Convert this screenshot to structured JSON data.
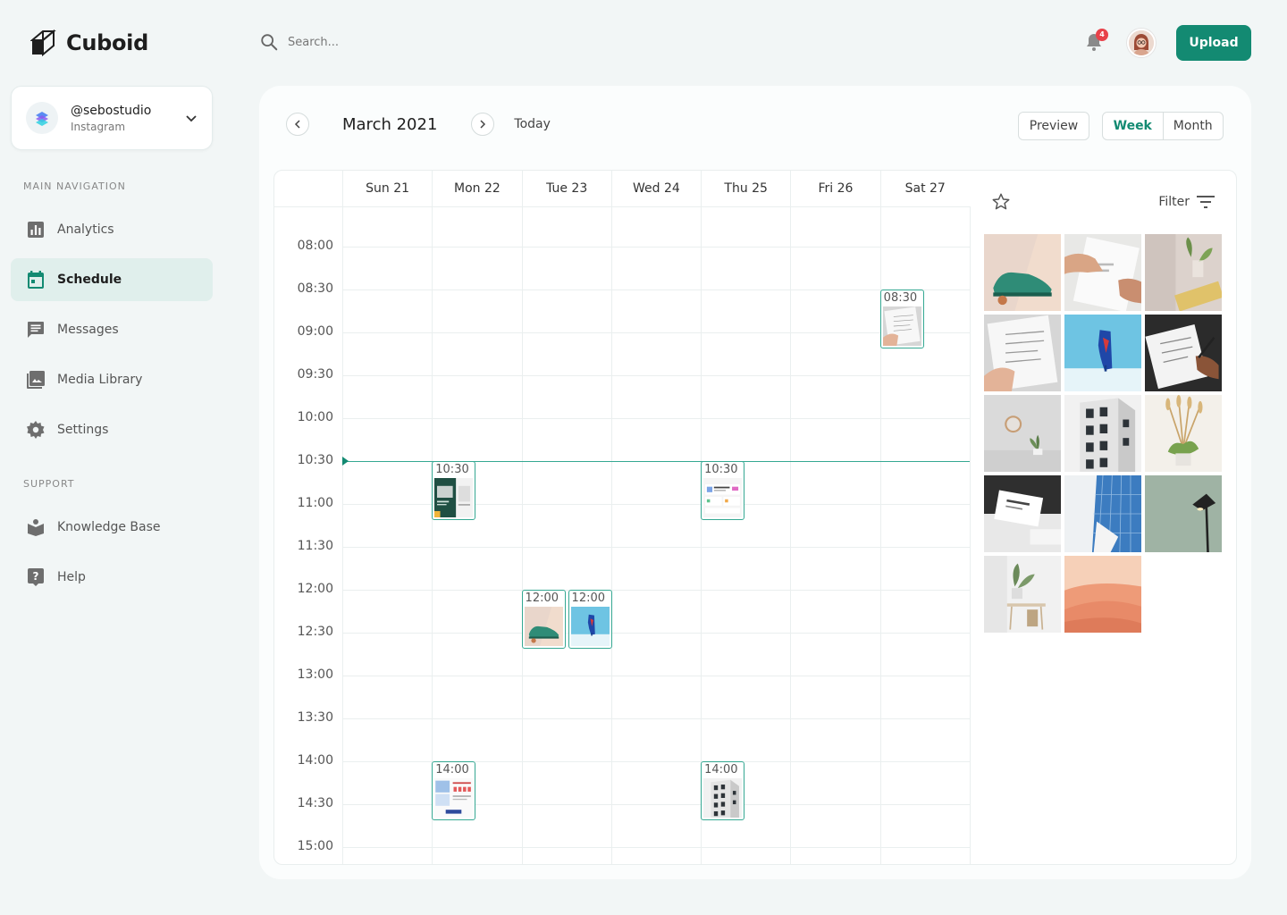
{
  "app": {
    "name": "Cuboid"
  },
  "search": {
    "placeholder": "Search..."
  },
  "notifications": {
    "count": "4"
  },
  "header": {
    "upload_label": "Upload"
  },
  "account": {
    "handle": "@sebostudio",
    "platform": "Instagram"
  },
  "sidebar": {
    "main_title": "MAIN NAVIGATION",
    "main_items": [
      {
        "label": "Analytics",
        "icon": "bar-chart-icon"
      },
      {
        "label": "Schedule",
        "icon": "calendar-icon",
        "active": true
      },
      {
        "label": "Messages",
        "icon": "message-icon"
      },
      {
        "label": "Media Library",
        "icon": "image-icon"
      },
      {
        "label": "Settings",
        "icon": "gear-icon"
      }
    ],
    "support_title": "SUPPORT",
    "support_items": [
      {
        "label": "Knowledge Base",
        "icon": "book-icon"
      },
      {
        "label": "Help",
        "icon": "help-icon"
      }
    ]
  },
  "calendar": {
    "month": "March 2021",
    "today_label": "Today",
    "preview_label": "Preview",
    "views": [
      "Week",
      "Month"
    ],
    "active_view": "Week",
    "days": [
      "Sun 21",
      "Mon 22",
      "Tue 23",
      "Wed 24",
      "Thu 25",
      "Fri 26",
      "Sat 27"
    ],
    "times": [
      "08:00",
      "08:30",
      "09:00",
      "09:30",
      "10:00",
      "10:30",
      "11:00",
      "11:30",
      "12:00",
      "12:30",
      "13:00",
      "13:30",
      "14:00",
      "14:30",
      "15:00"
    ],
    "current_time": "10:30",
    "events": [
      {
        "day": 6,
        "time": "08:30",
        "thumb": "notebook"
      },
      {
        "day": 1,
        "time": "10:30",
        "thumb": "green-flyer"
      },
      {
        "day": 4,
        "time": "10:30",
        "thumb": "web-design"
      },
      {
        "day": 2,
        "time": "12:00",
        "thumb": "green-shoe"
      },
      {
        "day": 2,
        "time": "12:00",
        "thumb": "blue-heel",
        "offset": 1
      },
      {
        "day": 1,
        "time": "14:00",
        "thumb": "infographic"
      },
      {
        "day": 4,
        "time": "14:00",
        "thumb": "building"
      }
    ]
  },
  "media": {
    "filter_label": "Filter",
    "thumbnails": [
      "green-shoe",
      "paper-hands",
      "plant-sign",
      "notebook",
      "blue-heel",
      "signing",
      "wall-clock",
      "building",
      "dried-plant",
      "business-card",
      "glass-tower",
      "desk-lamp",
      "interior",
      "desert"
    ]
  },
  "colors": {
    "accent": "#138a72",
    "accent_light": "#e0efec",
    "badge": "#e8424a",
    "event_border": "#35a892"
  }
}
